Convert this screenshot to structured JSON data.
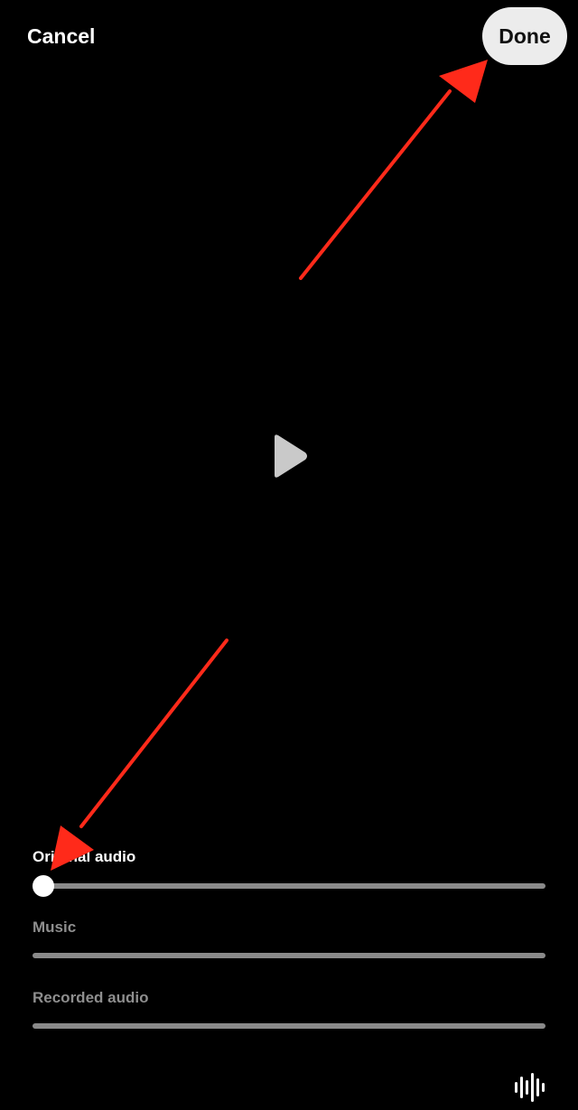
{
  "header": {
    "cancel_label": "Cancel",
    "done_label": "Done"
  },
  "player": {
    "play_icon": "play-icon"
  },
  "audio_tracks": [
    {
      "label": "Original audio",
      "volume_fraction": 0.0,
      "active": true
    },
    {
      "label": "Music",
      "volume_fraction": null,
      "active": false
    },
    {
      "label": "Recorded audio",
      "volume_fraction": null,
      "active": false
    }
  ],
  "footer": {
    "waveform_icon": "waveform-icon"
  },
  "colors": {
    "background": "#000000",
    "done_button_bg": "#ececec",
    "slider_track": "#8a8a8a",
    "inactive_label": "#8e8e8e",
    "annotation_arrow": "#ff2a1a"
  }
}
